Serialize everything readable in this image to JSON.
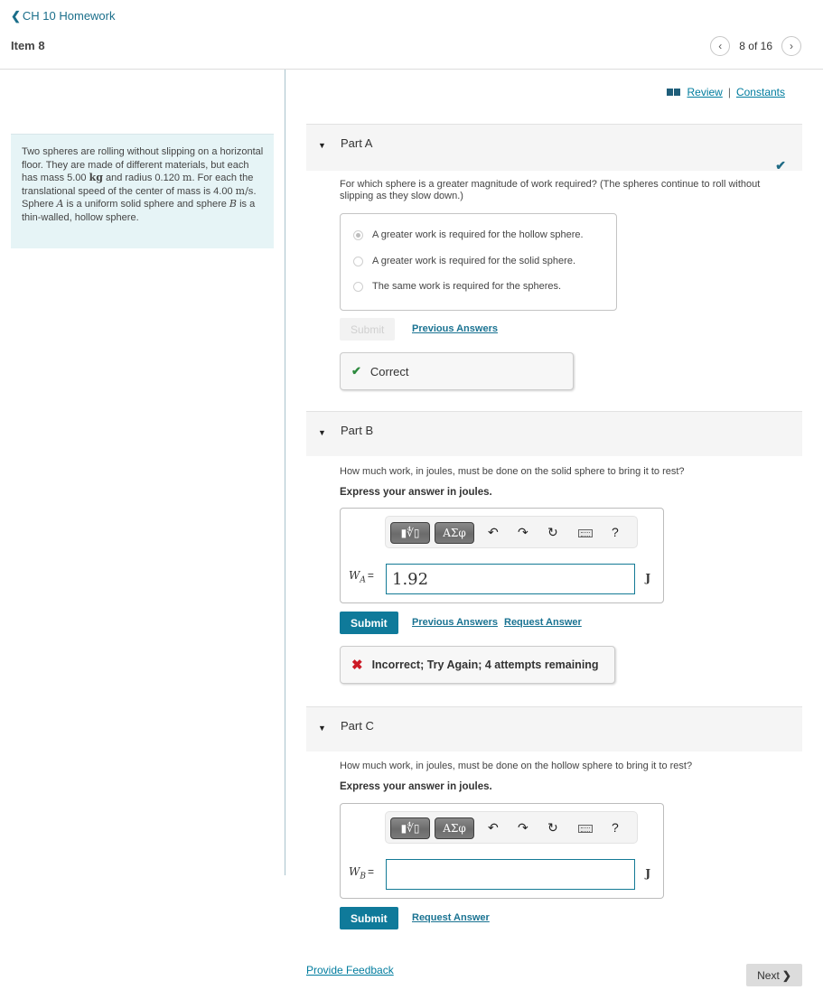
{
  "header": {
    "back_link": "CH 10 Homework",
    "back_chevron": "❮",
    "item_title": "Item 8",
    "pager": {
      "prev_icon": "‹",
      "count": "8 of 16",
      "next_icon": "›"
    }
  },
  "links": {
    "review": "Review",
    "separator": "|",
    "constants": "Constants",
    "provide_feedback": "Provide Feedback"
  },
  "problem": {
    "t1": "Two spheres are rolling without slipping on a horizontal floor. They are made of different materials, but each has mass 5.00 ",
    "mass_unit": "kg",
    "t2": " and radius 0.120 ",
    "radius_unit": "m",
    "t3": ". For each the translational speed of the center of mass is 4.00 ",
    "speed_unit": "m/s",
    "t4": ". Sphere ",
    "sphere_a": "A",
    "t5": " is a uniform solid sphere and sphere ",
    "sphere_b": "B",
    "t6": " is a thin-walled, hollow sphere."
  },
  "parts": [
    {
      "title": "Part A",
      "status_icon": "✔",
      "question": "For which sphere is a greater magnitude of work required? (The spheres continue to roll without slipping as they slow down.)",
      "choices": [
        {
          "label": "A greater work is required for the hollow sphere.",
          "selected": true
        },
        {
          "label": "A greater work is required for the solid sphere.",
          "selected": false
        },
        {
          "label": "The same work is required for the spheres.",
          "selected": false
        }
      ],
      "submit_label": "Submit",
      "previous_answers": "Previous Answers",
      "feedback": {
        "icon": "✔",
        "text": "Correct"
      }
    },
    {
      "title": "Part B",
      "question": "How much work, in joules, must be done on the solid sphere to bring it to rest?",
      "instruction": "Express your answer in joules.",
      "variable": "W",
      "subscript": "A",
      "equals": "=",
      "answer_value": "1.92",
      "unit": "J",
      "submit_label": "Submit",
      "previous_answers": "Previous Answers",
      "request_answer": "Request Answer",
      "feedback": {
        "icon": "✖",
        "text": "Incorrect; Try Again; 4 attempts remaining"
      }
    },
    {
      "title": "Part C",
      "question": "How much work, in joules, must be done on the hollow sphere to bring it to rest?",
      "instruction": "Express your answer in joules.",
      "variable": "W",
      "subscript": "B",
      "equals": "=",
      "answer_value": "",
      "unit": "J",
      "submit_label": "Submit",
      "request_answer": "Request Answer"
    }
  ],
  "toolbar": {
    "templates_label": "▮∜▯",
    "greek_label": "ΑΣφ",
    "undo_icon": "↶",
    "redo_icon": "↷",
    "reset_icon": "↻",
    "help_label": "?"
  },
  "next_button": {
    "label": "Next",
    "chevron": "❯"
  },
  "colors": {
    "accent": "#0f7a9a",
    "link": "#007c9e",
    "correct": "#2d8a3e",
    "incorrect": "#cc1a26",
    "problem_bg": "#e6f4f6"
  }
}
